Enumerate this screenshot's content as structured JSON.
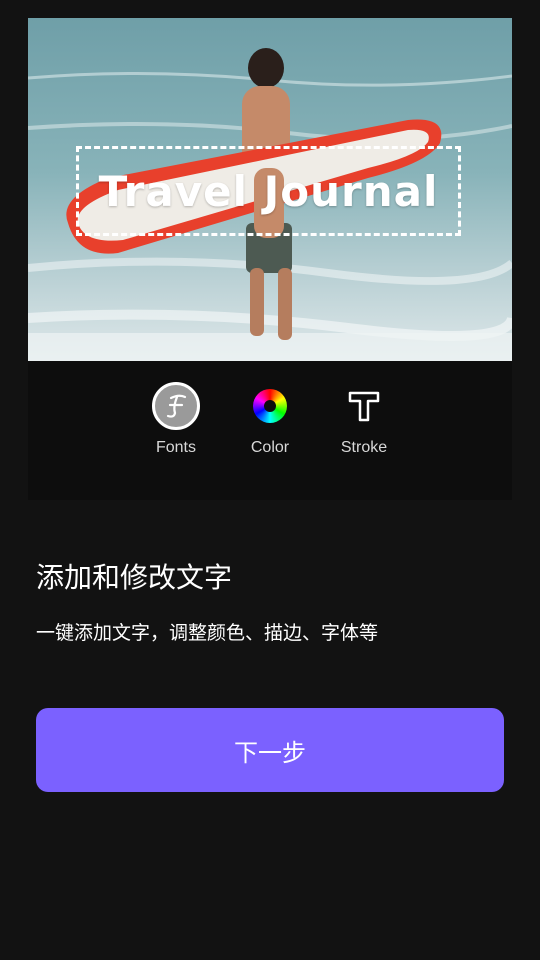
{
  "preview": {
    "overlay_text": "Travel Journal"
  },
  "toolbar": {
    "fonts_label": "Fonts",
    "color_label": "Color",
    "stroke_label": "Stroke"
  },
  "feature": {
    "title": "添加和修改文字",
    "description": "一键添加文字，调整颜色、描边、字体等"
  },
  "actions": {
    "next_label": "下一步"
  },
  "colors": {
    "accent": "#7b61ff",
    "background": "#121212",
    "toolbar_bg": "#0d0d0d"
  },
  "icons": [
    "fonts-icon",
    "color-wheel-icon",
    "stroke-icon"
  ]
}
